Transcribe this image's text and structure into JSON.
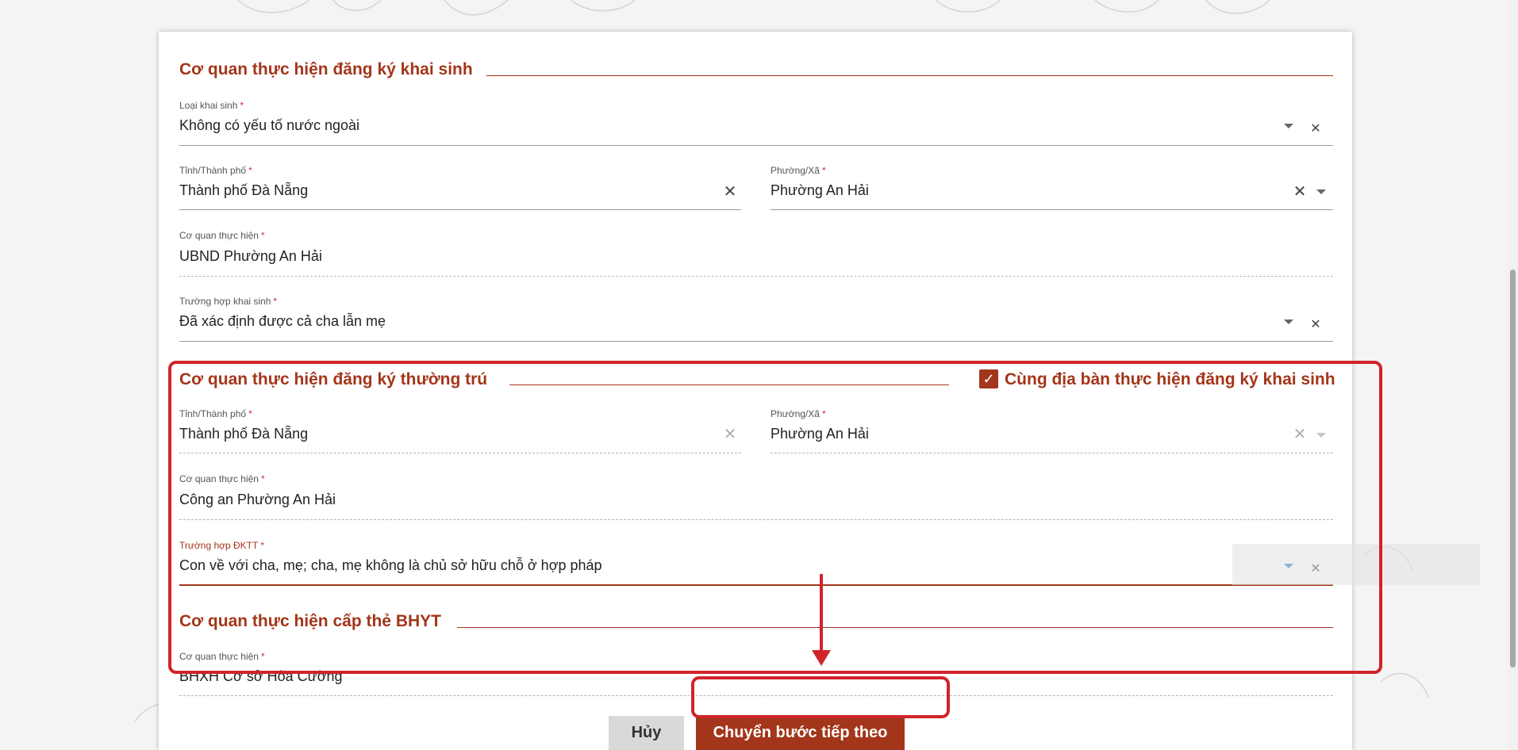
{
  "section_birth": {
    "title": "Cơ quan thực hiện đăng ký khai sinh",
    "birth_type": {
      "label": "Loại khai sinh",
      "value": "Không có yếu tố nước ngoài"
    },
    "province": {
      "label": "Tỉnh/Thành phố",
      "value": "Thành phố Đà Nẵng"
    },
    "ward": {
      "label": "Phường/Xã",
      "value": "Phường An Hải"
    },
    "agency": {
      "label": "Cơ quan thực hiện",
      "value": "UBND Phường An Hải"
    },
    "case": {
      "label": "Trường hợp khai sinh",
      "value": "Đã xác định được cả cha lẫn mẹ"
    }
  },
  "section_residence": {
    "title": "Cơ quan thực hiện đăng ký thường trú",
    "same_area_label": "Cùng địa bàn thực hiện đăng ký khai sinh",
    "province": {
      "label": "Tỉnh/Thành phố",
      "value": "Thành phố Đà Nẵng"
    },
    "ward": {
      "label": "Phường/Xã",
      "value": "Phường An Hải"
    },
    "agency": {
      "label": "Cơ quan thực hiện",
      "value": "Công an Phường An Hải"
    },
    "case": {
      "label": "Trường hợp ĐKTT",
      "value": "Con về với cha, mẹ; cha, mẹ không là chủ sở hữu chỗ ở hợp pháp"
    }
  },
  "section_insurance": {
    "title": "Cơ quan thực hiện cấp thẻ BHYT",
    "agency": {
      "label": "Cơ quan thực hiện",
      "value": "BHXH Cơ sở Hòa Cường"
    }
  },
  "buttons": {
    "cancel": "Hủy",
    "next": "Chuyển bước tiếp theo"
  },
  "icons": {
    "clear": "close-icon",
    "dropdown": "chevron-down-icon",
    "check": "check-icon"
  },
  "colors": {
    "accent": "#a3361a",
    "highlight": "#d0242b",
    "required": "#d32f2f"
  }
}
